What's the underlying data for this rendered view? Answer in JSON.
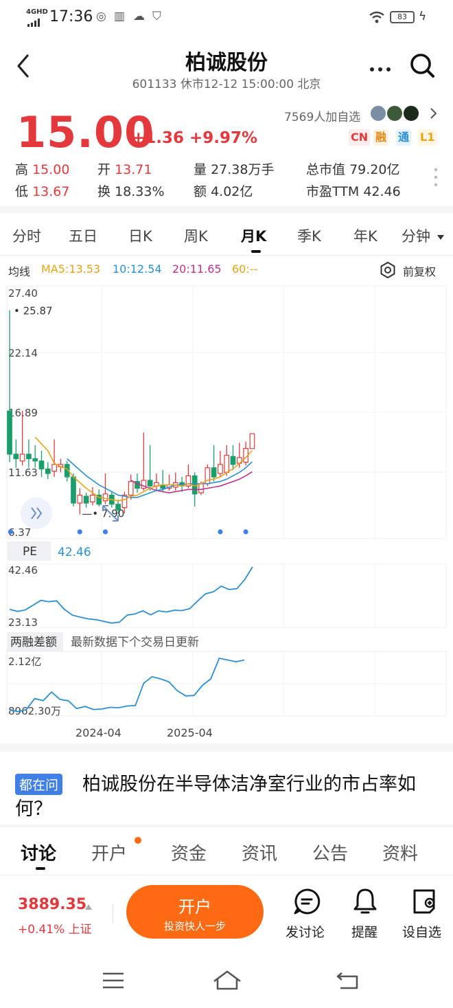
{
  "status_bar": {
    "network": "4GHD",
    "time": "17:36",
    "battery": "83"
  },
  "header": {
    "title": "柏诚股份",
    "subtitle": "601133 休市12-12 15:00:00 北京"
  },
  "quote": {
    "price": "15.00",
    "change": "+1.36 +9.97%",
    "follow_count": "7569人加自选",
    "tags": [
      "CN",
      "融",
      "通",
      "L1"
    ],
    "stats": [
      {
        "label": "高",
        "value": "15.00",
        "color": "red"
      },
      {
        "label": "开",
        "value": "13.71",
        "color": "red"
      },
      {
        "label": "量",
        "value": "27.38万手",
        "color": "dark"
      },
      {
        "label": "总市值",
        "value": "79.20亿",
        "color": "dark"
      },
      {
        "label": "低",
        "value": "13.67",
        "color": "red"
      },
      {
        "label": "换",
        "value": "18.33%",
        "color": "dark"
      },
      {
        "label": "额",
        "value": "4.02亿",
        "color": "dark"
      },
      {
        "label": "市盈TTM",
        "value": "42.46",
        "color": "dark"
      }
    ]
  },
  "period_tabs": [
    "分时",
    "五日",
    "日K",
    "周K",
    "月K",
    "季K",
    "年K",
    "分钟"
  ],
  "active_tab": "月K",
  "ma_line": {
    "label": "均线",
    "ma5": "MA5:13.53",
    "ma10": "10:12.54",
    "ma20": "20:11.65",
    "ma60": "60:--",
    "adjust": "前复权"
  },
  "colors": {
    "up": "#e4393c",
    "down": "#1a9e6b",
    "ma5": "#e8a317",
    "ma10": "#2a8fd6",
    "ma20": "#c0308a",
    "line": "#2a8fd6",
    "accent": "#ff6a13"
  },
  "chart_data": [
    {
      "type": "candlestick",
      "title": "月K",
      "y_ticks": [
        "27.40",
        "22.14",
        "16.89",
        "11.63",
        "6.37"
      ],
      "ylim": [
        6.37,
        27.4
      ],
      "annotations": {
        "high": "25.87",
        "low": "7.90"
      },
      "candles": [
        {
          "o": 17.0,
          "c": 13.2,
          "h": 25.87,
          "l": 12.5
        },
        {
          "o": 13.2,
          "c": 12.8,
          "h": 14.5,
          "l": 12.0
        },
        {
          "o": 12.6,
          "c": 13.2,
          "h": 17.0,
          "l": 12.2
        },
        {
          "o": 13.2,
          "c": 12.8,
          "h": 14.5,
          "l": 12.0
        },
        {
          "o": 12.8,
          "c": 12.6,
          "h": 14.0,
          "l": 12.0
        },
        {
          "o": 12.6,
          "c": 11.9,
          "h": 13.5,
          "l": 11.2
        },
        {
          "o": 11.9,
          "c": 11.5,
          "h": 12.5,
          "l": 11.0
        },
        {
          "o": 11.7,
          "c": 12.3,
          "h": 14.5,
          "l": 11.2
        },
        {
          "o": 12.1,
          "c": 12.3,
          "h": 12.8,
          "l": 11.6
        },
        {
          "o": 12.3,
          "c": 11.2,
          "h": 12.6,
          "l": 10.8
        },
        {
          "o": 11.2,
          "c": 8.9,
          "h": 11.5,
          "l": 8.6
        },
        {
          "o": 8.9,
          "c": 9.6,
          "h": 10.2,
          "l": 7.9
        },
        {
          "o": 9.5,
          "c": 8.9,
          "h": 9.8,
          "l": 8.5
        },
        {
          "o": 9.0,
          "c": 9.6,
          "h": 10.3,
          "l": 8.7
        },
        {
          "o": 9.6,
          "c": 8.8,
          "h": 10.1,
          "l": 8.6
        },
        {
          "o": 9.1,
          "c": 9.7,
          "h": 11.5,
          "l": 8.8
        },
        {
          "o": 9.6,
          "c": 8.8,
          "h": 9.9,
          "l": 8.5
        },
        {
          "o": 8.8,
          "c": 8.3,
          "h": 9.2,
          "l": 7.95
        },
        {
          "o": 8.5,
          "c": 9.6,
          "h": 9.9,
          "l": 8.0
        },
        {
          "o": 9.6,
          "c": 10.8,
          "h": 11.4,
          "l": 9.2
        },
        {
          "o": 10.8,
          "c": 10.2,
          "h": 11.5,
          "l": 9.8
        },
        {
          "o": 10.2,
          "c": 10.9,
          "h": 15.1,
          "l": 10.0
        },
        {
          "o": 10.9,
          "c": 10.4,
          "h": 14.0,
          "l": 10.0
        },
        {
          "o": 10.4,
          "c": 10.7,
          "h": 11.5,
          "l": 10.0
        },
        {
          "o": 10.5,
          "c": 10.2,
          "h": 11.8,
          "l": 9.9
        },
        {
          "o": 10.2,
          "c": 10.5,
          "h": 11.4,
          "l": 10.0
        },
        {
          "o": 10.3,
          "c": 10.7,
          "h": 11.6,
          "l": 10.0
        },
        {
          "o": 10.7,
          "c": 10.4,
          "h": 11.2,
          "l": 9.9
        },
        {
          "o": 10.4,
          "c": 11.3,
          "h": 12.3,
          "l": 10.2
        },
        {
          "o": 11.3,
          "c": 9.7,
          "h": 11.6,
          "l": 8.6
        },
        {
          "o": 9.8,
          "c": 10.6,
          "h": 10.8,
          "l": 9.6
        },
        {
          "o": 10.6,
          "c": 12.0,
          "h": 12.3,
          "l": 10.4
        },
        {
          "o": 12.0,
          "c": 11.2,
          "h": 14.0,
          "l": 10.8
        },
        {
          "o": 11.5,
          "c": 12.3,
          "h": 13.5,
          "l": 11.2
        },
        {
          "o": 11.6,
          "c": 13.1,
          "h": 14.0,
          "l": 11.3
        },
        {
          "o": 13.0,
          "c": 12.3,
          "h": 14.0,
          "l": 11.8
        },
        {
          "o": 12.4,
          "c": 12.9,
          "h": 14.2,
          "l": 12.0
        },
        {
          "o": 12.5,
          "c": 13.7,
          "h": 14.3,
          "l": 12.2
        },
        {
          "o": 13.7,
          "c": 15.0,
          "h": 15.0,
          "l": 13.67
        }
      ],
      "ma5": [
        null,
        null,
        null,
        null,
        14.7,
        14.1,
        13.5,
        12.4,
        12.1,
        11.9,
        11.2,
        10.7,
        10.2,
        9.8,
        9.4,
        9.3,
        9.2,
        9.1,
        9.2,
        9.5,
        9.6,
        9.9,
        10.2,
        10.4,
        10.5,
        10.5,
        10.5,
        10.4,
        10.6,
        10.4,
        10.6,
        10.9,
        11.0,
        11.2,
        11.6,
        11.9,
        12.4,
        12.9,
        13.53
      ],
      "ma10": [
        null,
        null,
        null,
        null,
        null,
        null,
        null,
        null,
        null,
        12.8,
        12.3,
        11.8,
        11.3,
        10.9,
        10.5,
        10.2,
        9.9,
        9.6,
        9.5,
        9.4,
        9.4,
        9.6,
        9.8,
        10.0,
        10.1,
        10.3,
        10.5,
        10.5,
        10.6,
        10.6,
        10.6,
        10.6,
        10.7,
        10.8,
        11.0,
        11.3,
        11.6,
        12.0,
        12.54
      ],
      "ma20": [
        null,
        null,
        null,
        null,
        null,
        null,
        null,
        null,
        null,
        null,
        null,
        null,
        null,
        null,
        null,
        null,
        null,
        null,
        null,
        10.9,
        10.6,
        10.4,
        10.2,
        10.0,
        9.9,
        9.8,
        9.9,
        10.0,
        10.1,
        10.1,
        10.1,
        10.2,
        10.3,
        10.4,
        10.6,
        10.8,
        11.0,
        11.3,
        11.65
      ],
      "markers": [
        1,
        11,
        15,
        33,
        37
      ]
    },
    {
      "type": "line",
      "title": "PE",
      "label": "42.46",
      "y_ticks": [
        "42.46",
        "23.13"
      ],
      "ylim": [
        23.13,
        42.46
      ],
      "values": [
        27.5,
        26.8,
        27.3,
        29.0,
        30.7,
        30.2,
        30.5,
        27.5,
        25.5,
        24.8,
        24.2,
        23.9,
        23.3,
        22.7,
        23.0,
        25.5,
        25.9,
        27.0,
        25.6,
        27.0,
        26.6,
        27.2,
        27.1,
        27.8,
        30.5,
        33.0,
        33.7,
        35.7,
        34.5,
        34.8,
        38.0,
        42.46
      ]
    },
    {
      "type": "line",
      "title": "两融差额",
      "note": "最新数据下个交易日更新",
      "y_ticks": [
        "2.12亿",
        "8962.30万"
      ],
      "values": [
        0.95,
        0.9,
        0.95,
        1.2,
        1.15,
        1.35,
        1.18,
        1.15,
        0.97,
        1.02,
        0.95,
        0.96,
        1.0,
        0.99,
        1.03,
        1.04,
        1.55,
        1.7,
        1.65,
        1.58,
        1.38,
        1.26,
        1.27,
        1.5,
        1.65,
        2.12,
        2.08,
        2.04,
        2.08
      ],
      "x_ticks": [
        "2024-04",
        "2025-04"
      ]
    }
  ],
  "news": {
    "tag": "都在问",
    "text": "柏诚股份在半导体洁净室行业的市占率如何？"
  },
  "bottom_tabs": [
    "讨论",
    "开户",
    "资金",
    "资讯",
    "公告",
    "资料"
  ],
  "bottom_bar": {
    "index_value": "3889.35",
    "index_change": "+0.41% 上证",
    "open_account": "开户",
    "open_account_sub": "投资快人一步",
    "actions": [
      "发讨论",
      "提醒",
      "设自选"
    ]
  }
}
